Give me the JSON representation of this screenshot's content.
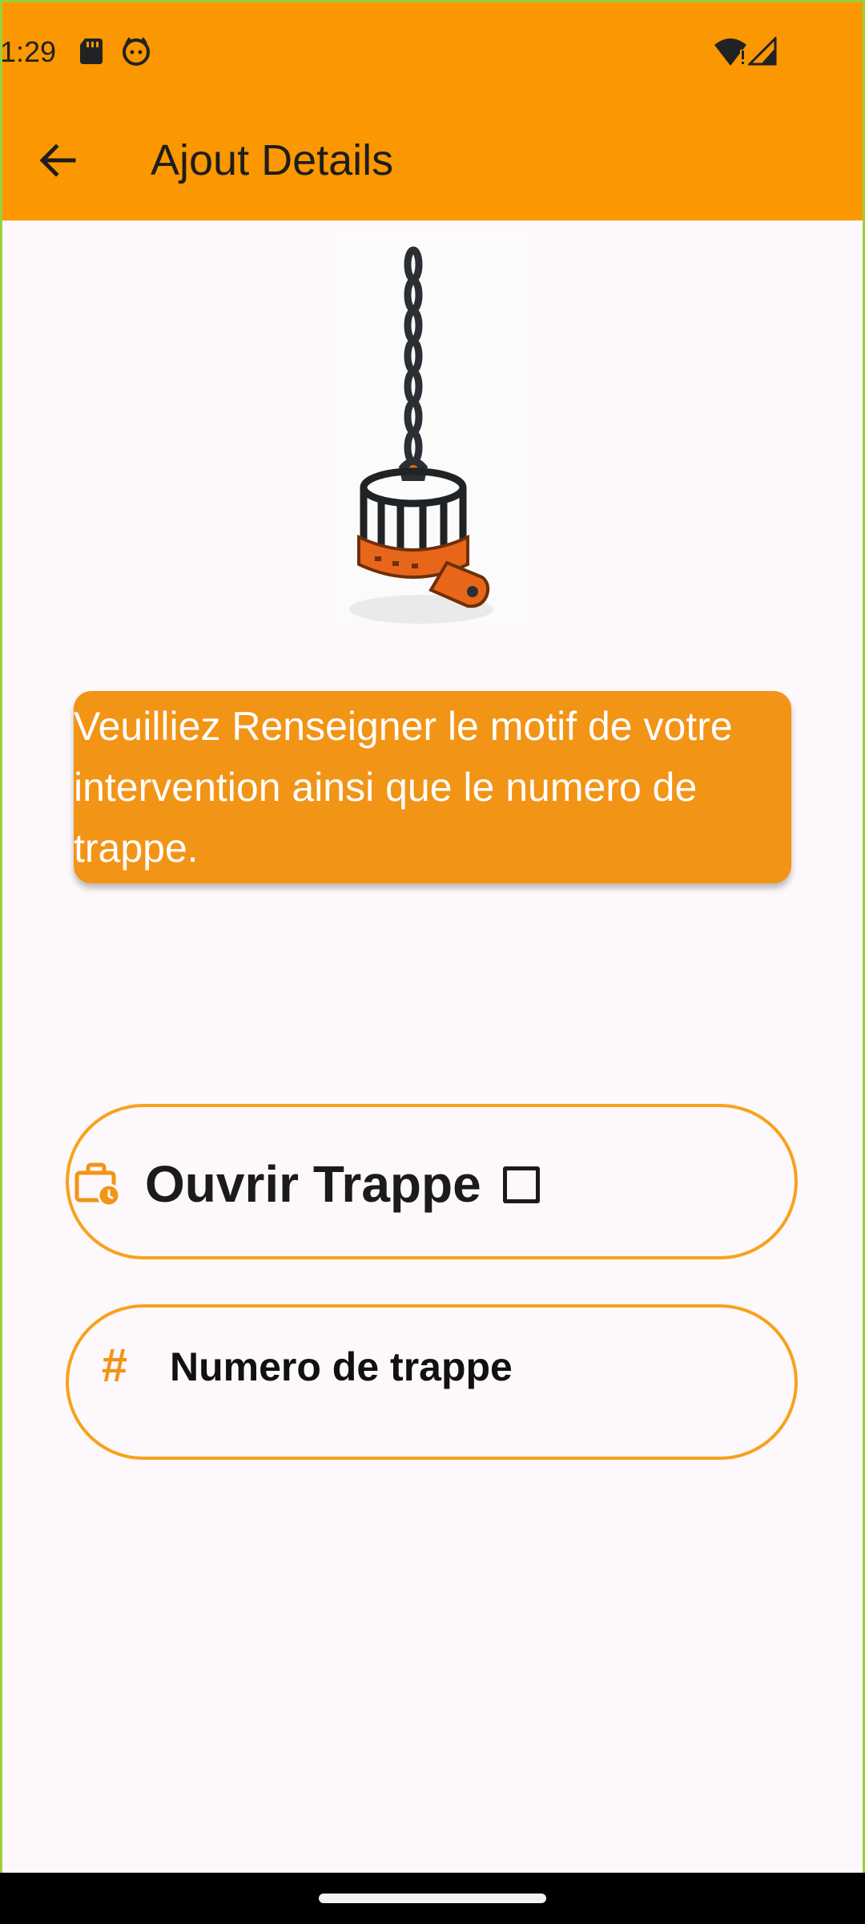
{
  "status_bar": {
    "time": "1:29",
    "icons": [
      "sd-card-icon",
      "cat-face-icon",
      "wifi-alert-icon",
      "cell-signal-icon"
    ]
  },
  "app_bar": {
    "title": "Ajout Details",
    "back_icon": "arrow-left-icon",
    "color": "#fb9700"
  },
  "illustration": {
    "subject": "chain-hook-cage-icon"
  },
  "message": {
    "text": "Veuilliez Renseigner le motif de votre intervention ainsi que le numero de trappe.",
    "background": "#f29416"
  },
  "form": {
    "open_trap": {
      "icon": "briefcase-clock-icon",
      "label": "Ouvrir Trappe",
      "checked": false
    },
    "trap_number": {
      "icon": "hash-icon",
      "placeholder": "Numero de trappe",
      "value": ""
    },
    "accent": "#f7a21c"
  }
}
